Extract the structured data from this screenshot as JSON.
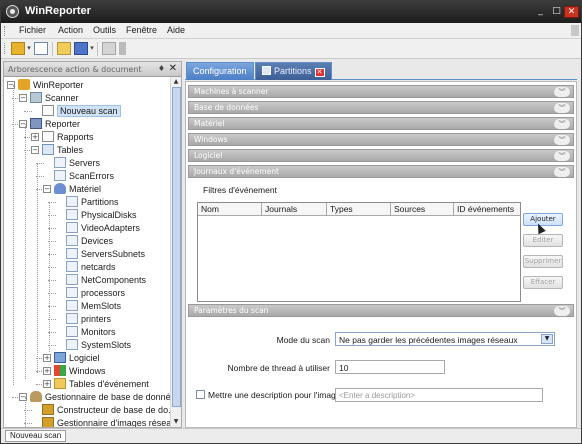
{
  "window": {
    "title": "WinReporter",
    "min_label": "_",
    "max_label": "□",
    "close_label": "✕"
  },
  "menu": [
    "Fichier",
    "Action",
    "Outils",
    "Fenêtre",
    "Aide"
  ],
  "left_panel": {
    "title": "Arborescence action & document",
    "pin": "♦",
    "close": "✕",
    "tree": [
      {
        "label": "WinReporter",
        "icon": "app-icon",
        "expander": "−"
      },
      {
        "label": "Scanner",
        "icon": "scanner-icon",
        "expander": "−"
      },
      {
        "label": "Nouveau scan",
        "icon": "scan-icon",
        "selected": true
      },
      {
        "label": "Reporter",
        "icon": "report-icon",
        "expander": "−"
      },
      {
        "label": "Rapports",
        "icon": "page-icon",
        "expander": "+"
      },
      {
        "label": "Tables",
        "icon": "table-icon",
        "expander": "−"
      },
      {
        "label": "Servers",
        "icon": "grid-icon"
      },
      {
        "label": "ScanErrors",
        "icon": "grid-icon"
      },
      {
        "label": "Matériel",
        "icon": "user-icon",
        "expander": "−"
      },
      {
        "label": "Partitions",
        "icon": "grid-icon"
      },
      {
        "label": "PhysicalDisks",
        "icon": "grid-icon"
      },
      {
        "label": "VideoAdapters",
        "icon": "grid-icon"
      },
      {
        "label": "Devices",
        "icon": "grid-icon"
      },
      {
        "label": "ServersSubnets",
        "icon": "grid-icon"
      },
      {
        "label": "netcards",
        "icon": "grid-icon"
      },
      {
        "label": "NetComponents",
        "icon": "grid-icon"
      },
      {
        "label": "processors",
        "icon": "grid-icon"
      },
      {
        "label": "MemSlots",
        "icon": "grid-icon"
      },
      {
        "label": "printers",
        "icon": "grid-icon"
      },
      {
        "label": "Monitors",
        "icon": "grid-icon"
      },
      {
        "label": "SystemSlots",
        "icon": "grid-icon"
      },
      {
        "label": "Logiciel",
        "icon": "monitor-icon",
        "expander": "+"
      },
      {
        "label": "Windows",
        "icon": "windows-icon",
        "expander": "+"
      },
      {
        "label": "Tables d'événement",
        "icon": "folder-icon",
        "expander": "+"
      },
      {
        "label": "Gestionnaire de base de données",
        "icon": "database-icon",
        "expander": "−"
      },
      {
        "label": "Constructeur de base de do...",
        "icon": "wrench-icon"
      },
      {
        "label": "Gestionnaire d'images réseau",
        "icon": "wrench-icon"
      }
    ]
  },
  "tabs": [
    {
      "label": "Configuration",
      "active": true
    },
    {
      "label": "Partitions",
      "active": false,
      "close": "✕"
    }
  ],
  "sections": [
    "Machines à scanner",
    "Base de données",
    "Matériel",
    "Windows",
    "Logiciel",
    "Journaux d'événement"
  ],
  "section_chevron": "︾",
  "events": {
    "group_label": "Filtres d'événement",
    "columns": [
      "Nom",
      "Journals",
      "Types",
      "Sources",
      "ID événements"
    ],
    "buttons": [
      {
        "label": "Ajouter",
        "enabled": true
      },
      {
        "label": "Editer",
        "enabled": false
      },
      {
        "label": "Supprimer",
        "enabled": false
      },
      {
        "label": "Effacer",
        "enabled": false
      }
    ]
  },
  "scan_params": {
    "section_title": "Paramètres du scan",
    "mode_label": "Mode du scan",
    "mode_value": "Ne pas garder les précédentes images réseaux",
    "threads_label": "Nombre de thread à utiliser",
    "threads_value": "10",
    "description_label": "Mettre une description pour l'image",
    "description_placeholder": "<Enter a description>"
  },
  "status": {
    "tab_label": "Nouveau scan"
  }
}
